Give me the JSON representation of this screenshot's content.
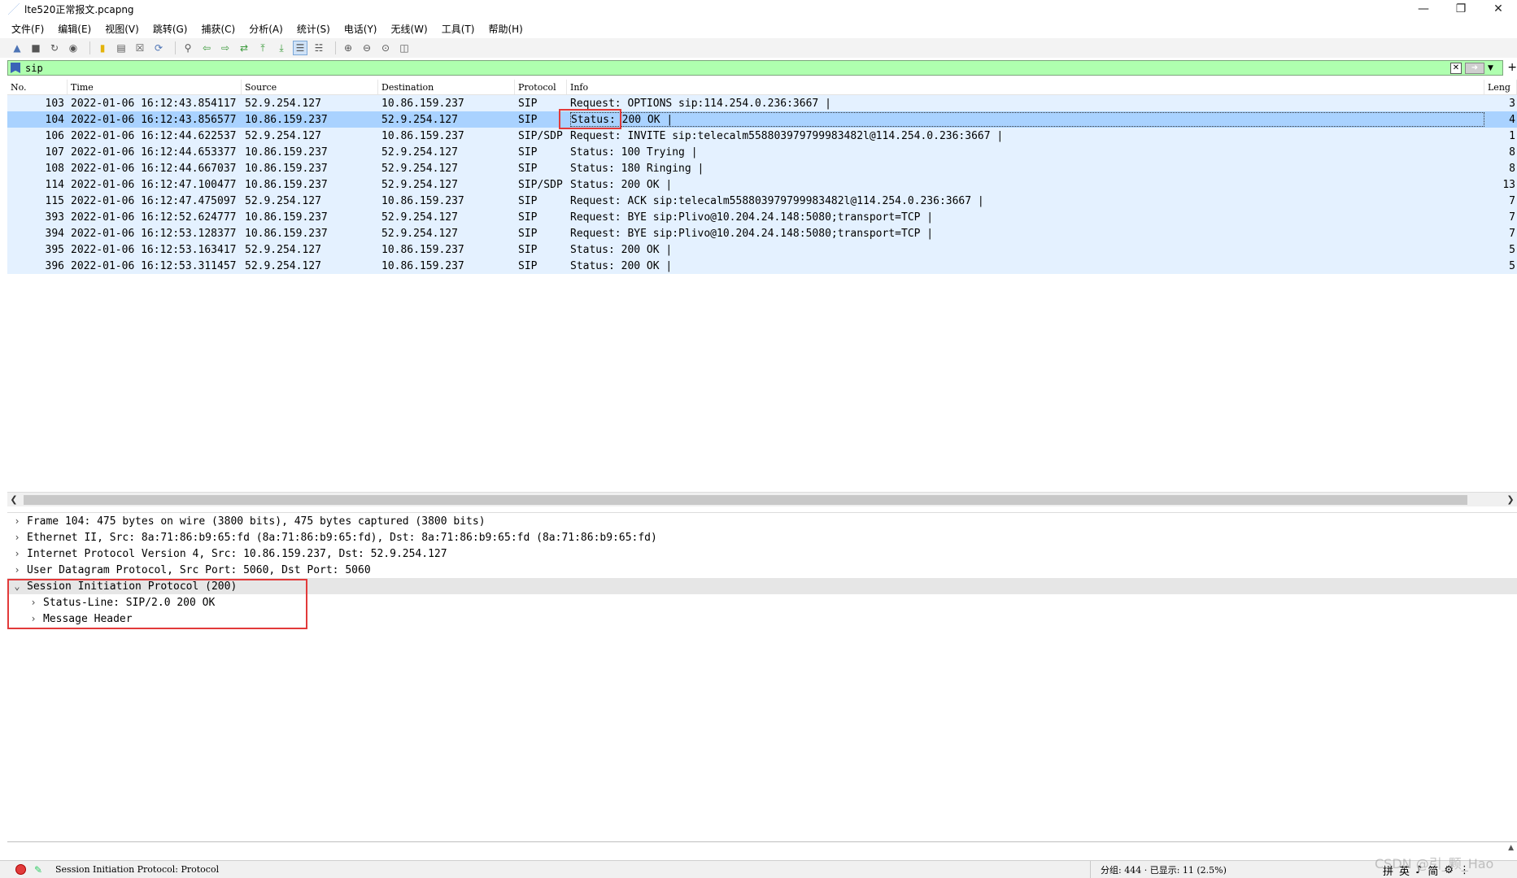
{
  "window": {
    "title": "lte520正常报文.pcapng"
  },
  "menu": {
    "items": [
      "文件(F)",
      "编辑(E)",
      "视图(V)",
      "跳转(G)",
      "捕获(C)",
      "分析(A)",
      "统计(S)",
      "电话(Y)",
      "无线(W)",
      "工具(T)",
      "帮助(H)"
    ]
  },
  "filter": {
    "value": "sip"
  },
  "packet_list": {
    "headers": {
      "no": "No.",
      "time": "Time",
      "source": "Source",
      "destination": "Destination",
      "protocol": "Protocol",
      "info": "Info",
      "length": "Leng"
    },
    "rows": [
      {
        "no": "103",
        "time": "2022-01-06 16:12:43.854117",
        "source": "52.9.254.127",
        "destination": "10.86.159.237",
        "protocol": "SIP",
        "info": "Request: OPTIONS sip:114.254.0.236:3667 |",
        "length": "3"
      },
      {
        "no": "104",
        "time": "2022-01-06 16:12:43.856577",
        "source": "10.86.159.237",
        "destination": "52.9.254.127",
        "protocol": "SIP",
        "info": "Status: 200 OK |",
        "length": "4"
      },
      {
        "no": "106",
        "time": "2022-01-06 16:12:44.622537",
        "source": "52.9.254.127",
        "destination": "10.86.159.237",
        "protocol": "SIP/SDP",
        "info": "Request: INVITE sip:telecalm558803979799983482l@114.254.0.236:3667 |",
        "length": "1"
      },
      {
        "no": "107",
        "time": "2022-01-06 16:12:44.653377",
        "source": "10.86.159.237",
        "destination": "52.9.254.127",
        "protocol": "SIP",
        "info": "Status: 100 Trying |",
        "length": "8"
      },
      {
        "no": "108",
        "time": "2022-01-06 16:12:44.667037",
        "source": "10.86.159.237",
        "destination": "52.9.254.127",
        "protocol": "SIP",
        "info": "Status: 180 Ringing |",
        "length": "8"
      },
      {
        "no": "114",
        "time": "2022-01-06 16:12:47.100477",
        "source": "10.86.159.237",
        "destination": "52.9.254.127",
        "protocol": "SIP/SDP",
        "info": "Status: 200 OK |",
        "length": "13"
      },
      {
        "no": "115",
        "time": "2022-01-06 16:12:47.475097",
        "source": "52.9.254.127",
        "destination": "10.86.159.237",
        "protocol": "SIP",
        "info": "Request: ACK sip:telecalm558803979799983482l@114.254.0.236:3667 |",
        "length": "7"
      },
      {
        "no": "393",
        "time": "2022-01-06 16:12:52.624777",
        "source": "10.86.159.237",
        "destination": "52.9.254.127",
        "protocol": "SIP",
        "info": "Request: BYE sip:Plivo@10.204.24.148:5080;transport=TCP |",
        "length": "7"
      },
      {
        "no": "394",
        "time": "2022-01-06 16:12:53.128377",
        "source": "10.86.159.237",
        "destination": "52.9.254.127",
        "protocol": "SIP",
        "info": "Request: BYE sip:Plivo@10.204.24.148:5080;transport=TCP |",
        "length": "7"
      },
      {
        "no": "395",
        "time": "2022-01-06 16:12:53.163417",
        "source": "52.9.254.127",
        "destination": "10.86.159.237",
        "protocol": "SIP",
        "info": "Status: 200 OK |",
        "length": "5"
      },
      {
        "no": "396",
        "time": "2022-01-06 16:12:53.311457",
        "source": "52.9.254.127",
        "destination": "10.86.159.237",
        "protocol": "SIP",
        "info": "Status: 200 OK |",
        "length": "5"
      }
    ]
  },
  "details": {
    "rows": [
      {
        "text": "Frame 104: 475 bytes on wire (3800 bits), 475 bytes captured (3800 bits)",
        "expanded": false,
        "level": 0
      },
      {
        "text": "Ethernet II, Src: 8a:71:86:b9:65:fd (8a:71:86:b9:65:fd), Dst: 8a:71:86:b9:65:fd (8a:71:86:b9:65:fd)",
        "expanded": false,
        "level": 0
      },
      {
        "text": "Internet Protocol Version 4, Src: 10.86.159.237, Dst: 52.9.254.127",
        "expanded": false,
        "level": 0
      },
      {
        "text": "User Datagram Protocol, Src Port: 5060, Dst Port: 5060",
        "expanded": false,
        "level": 0
      },
      {
        "text": "Session Initiation Protocol (200)",
        "expanded": true,
        "level": 0
      },
      {
        "text": "Status-Line: SIP/2.0 200 OK",
        "expanded": false,
        "level": 1
      },
      {
        "text": "Message Header",
        "expanded": false,
        "level": 1
      }
    ]
  },
  "statusbar": {
    "field_text": "Session Initiation Protocol: Protocol",
    "packets": "分组: 444 · 已显示: 11 (2.5%)",
    "ime": [
      "拼",
      "英",
      "♪",
      "简",
      "⚙",
      "⋮"
    ]
  },
  "watermark": "CSDN @引_颗_Hao"
}
